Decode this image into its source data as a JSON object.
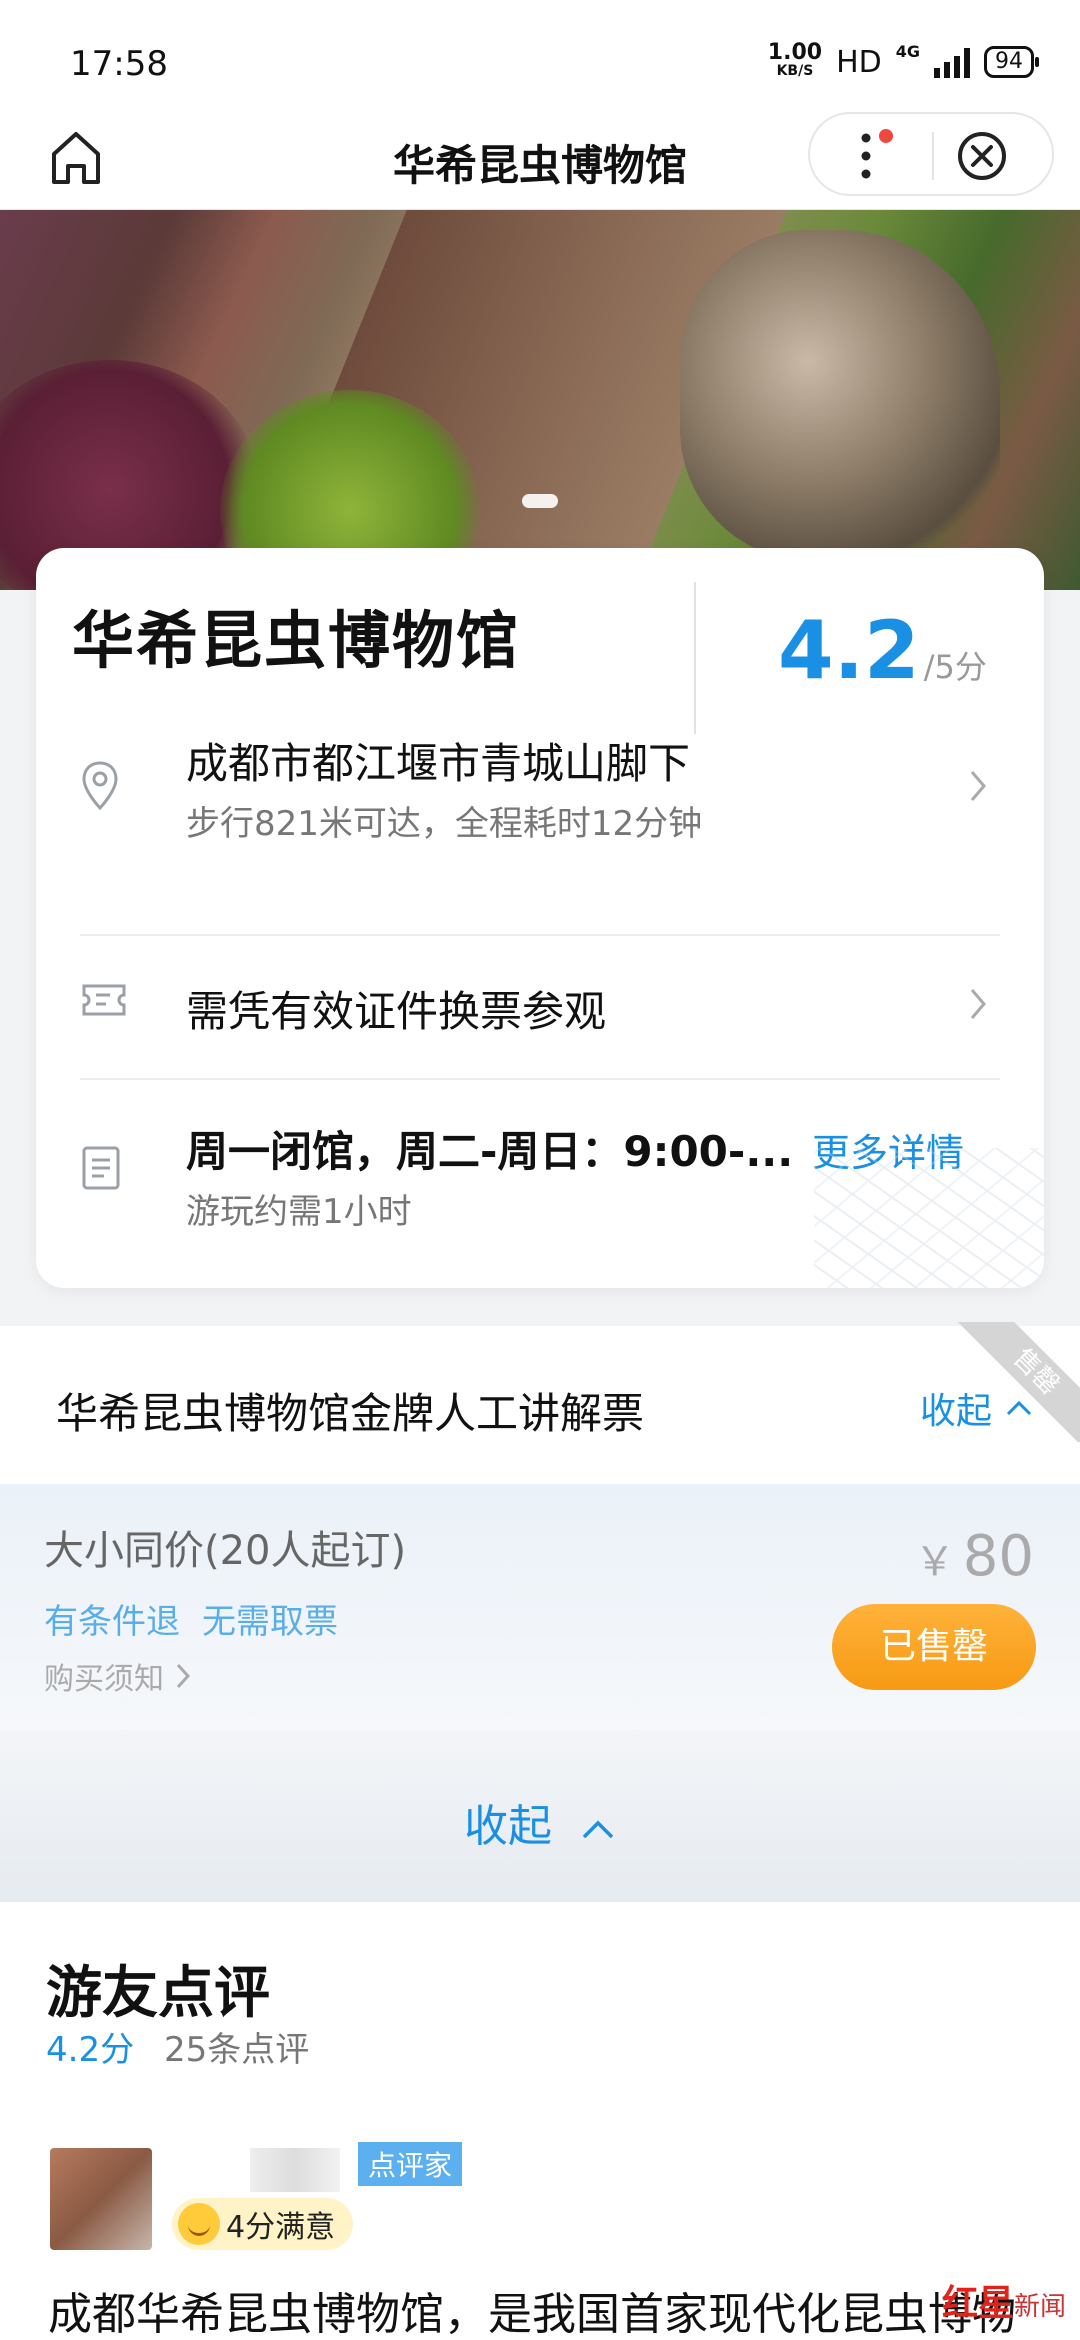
{
  "status_bar": {
    "time": "17:58",
    "net_speed_value": "1.00",
    "net_speed_unit": "KB/S",
    "hd": "HD",
    "network": "4G",
    "battery": "94"
  },
  "nav": {
    "title": "华希昆虫博物馆"
  },
  "card": {
    "title": "华希昆虫博物馆",
    "rating": "4.2",
    "rating_unit": "/5分",
    "address": "成都市都江堰市青城山脚下",
    "address_sub": "步行821米可达，全程耗时12分钟",
    "ticket_note": "需凭有效证件换票参观",
    "hours": "周一闭馆，周二-周日：9:00-...",
    "duration": "游玩约需1小时",
    "more": "更多详情"
  },
  "ticket": {
    "title": "华希昆虫博物馆金牌人工讲解票",
    "collapse": "收起",
    "ribbon": "售罄",
    "item_name": "大小同价(20人起订)",
    "tags": [
      "有条件退",
      "无需取票"
    ],
    "notice": "购买须知",
    "currency": "￥",
    "price": "80",
    "soldout_button": "已售罄"
  },
  "collapse_bar": {
    "label": "收起"
  },
  "reviews": {
    "title": "游友点评",
    "score": "4.2分",
    "count": "25条点评",
    "badge_reviewer": "点评家",
    "badge_satisfied": "4分满意",
    "text": "成都华希昆虫博物馆，是我国首家现代化昆虫博物"
  },
  "watermark": {
    "main": "红星",
    "sub": "新闻"
  },
  "colors": {
    "accent": "#1a90e4",
    "orange": "#f79a14"
  }
}
